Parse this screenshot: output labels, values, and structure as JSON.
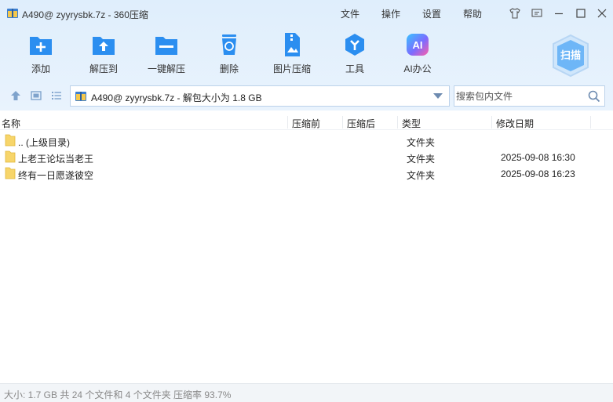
{
  "window": {
    "title": "A490@ zyyrysbk.7z - 360压缩"
  },
  "menu": {
    "file": "文件",
    "operation": "操作",
    "settings": "设置",
    "help": "帮助"
  },
  "toolbar": {
    "items": [
      {
        "label": "添加",
        "icon": "add-icon"
      },
      {
        "label": "解压到",
        "icon": "extract-to-icon"
      },
      {
        "label": "一键解压",
        "icon": "one-click-extract-icon"
      },
      {
        "label": "删除",
        "icon": "delete-icon"
      },
      {
        "label": "图片压缩",
        "icon": "image-compress-icon"
      },
      {
        "label": "工具",
        "icon": "tools-icon"
      },
      {
        "label": "AI办公",
        "icon": "ai-office-icon"
      }
    ],
    "scan_label": "扫描",
    "ai_badge": "AI"
  },
  "address": {
    "path": "A490@ zyyrysbk.7z - 解包大小为 1.8 GB"
  },
  "search": {
    "placeholder": "搜索包内文件"
  },
  "columns": {
    "name": "名称",
    "compressed_before": "压缩前",
    "compressed_after": "压缩后",
    "type": "类型",
    "modified": "修改日期"
  },
  "files": [
    {
      "name": ".. (上级目录)",
      "type": "文件夹",
      "modified": ""
    },
    {
      "name": "上老王论坛当老王",
      "type": "文件夹",
      "modified": "2025-09-08 16:30"
    },
    {
      "name": "终有一日愿遂彼空",
      "type": "文件夹",
      "modified": "2025-09-08 16:23"
    }
  ],
  "status": {
    "text": "大小: 1.7 GB 共 24 个文件和 4 个文件夹 压缩率 93.7%"
  },
  "colors": {
    "accent": "#2b8ef0",
    "toolbar_bg": "#e4f0fc",
    "folder": "#f7d56a"
  }
}
